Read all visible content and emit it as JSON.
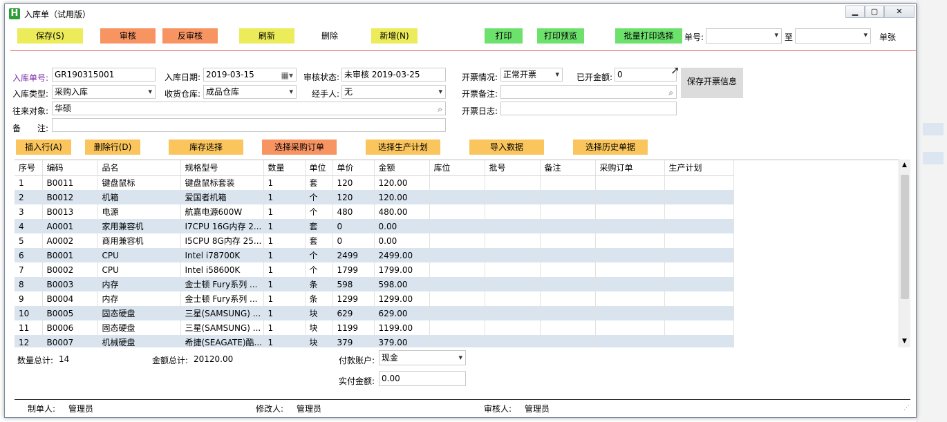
{
  "window": {
    "icon_letter": "H",
    "title": "入库单（试用版）",
    "min": "▭",
    "max": "◘",
    "close": "✕"
  },
  "toolbar": {
    "save": "保存(S)",
    "audit": "审核",
    "unaudit": "反审核",
    "refresh": "刷新",
    "delete": "删除",
    "new": "新增(N)",
    "print": "打印",
    "preview": "打印预览",
    "batch_print": "批量打印选择",
    "no_label": "单号:",
    "to_label": "至",
    "sheet_label": "单张"
  },
  "form": {
    "receipt_no_label": "入库单号:",
    "receipt_no": "GR190315001",
    "date_label": "入库日期:",
    "date": "2019-03-15",
    "audit_status_label": "审核状态:",
    "audit_status": "未审核 2019-03-25",
    "type_label": "入库类型:",
    "type": "采购入库",
    "warehouse_label": "收货仓库:",
    "warehouse": "成品仓库",
    "handler_label": "经手人:",
    "handler": "无",
    "partner_label": "往来对象:",
    "partner": "华硕",
    "remark_label": "备　　注:",
    "remark": "",
    "invoice_status_label": "开票情况:",
    "invoice_status": "正常开票",
    "invoiced_amount_label": "已开金额:",
    "invoiced_amount": "0",
    "invoice_remark_label": "开票备注:",
    "invoice_remark": "",
    "invoice_log_label": "开票日志:",
    "invoice_log": "",
    "save_invoice": "保存开票信息"
  },
  "row_buttons": {
    "insert": "插入行(A)",
    "delete": "删除行(D)",
    "stock": "库存选择",
    "purchase": "选择采购订单",
    "production": "选择生产计划",
    "import": "导入数据",
    "history": "选择历史单据"
  },
  "table": {
    "headers": [
      "序号",
      "编码",
      "品名",
      "规格型号",
      "数量",
      "单位",
      "单价",
      "金额",
      "库位",
      "批号",
      "备注",
      "采购订单",
      "生产计划"
    ],
    "rows": [
      [
        "1",
        "B0011",
        "键盘鼠标",
        "键盘鼠标套装",
        "1",
        "套",
        "120",
        "120.00",
        "",
        "",
        "",
        "",
        ""
      ],
      [
        "2",
        "B0012",
        "机箱",
        "爱国者机箱",
        "1",
        "个",
        "120",
        "120.00",
        "",
        "",
        "",
        "",
        ""
      ],
      [
        "3",
        "B0013",
        "电源",
        "航嘉电源600W",
        "1",
        "个",
        "480",
        "480.00",
        "",
        "",
        "",
        "",
        ""
      ],
      [
        "4",
        "A0001",
        "家用兼容机",
        "I7CPU 16G内存 2...",
        "1",
        "套",
        "0",
        "0.00",
        "",
        "",
        "",
        "",
        ""
      ],
      [
        "5",
        "A0002",
        "商用兼容机",
        "I5CPU 8G内存 25...",
        "1",
        "套",
        "0",
        "0.00",
        "",
        "",
        "",
        "",
        ""
      ],
      [
        "6",
        "B0001",
        "CPU",
        "Intel i78700K",
        "1",
        "个",
        "2499",
        "2499.00",
        "",
        "",
        "",
        "",
        ""
      ],
      [
        "7",
        "B0002",
        "CPU",
        "Intel i58600K",
        "1",
        "个",
        "1799",
        "1799.00",
        "",
        "",
        "",
        "",
        ""
      ],
      [
        "8",
        "B0003",
        "内存",
        "金士顿 Fury系列 ...",
        "1",
        "条",
        "598",
        "598.00",
        "",
        "",
        "",
        "",
        ""
      ],
      [
        "9",
        "B0004",
        "内存",
        "金士顿 Fury系列 ...",
        "1",
        "条",
        "1299",
        "1299.00",
        "",
        "",
        "",
        "",
        ""
      ],
      [
        "10",
        "B0005",
        "固态硬盘",
        "三星(SAMSUNG) ...",
        "1",
        "块",
        "629",
        "629.00",
        "",
        "",
        "",
        "",
        ""
      ],
      [
        "11",
        "B0006",
        "固态硬盘",
        "三星(SAMSUNG) ...",
        "1",
        "块",
        "1199",
        "1199.00",
        "",
        "",
        "",
        "",
        ""
      ],
      [
        "12",
        "B0007",
        "机械硬盘",
        "希捷(SEAGATE)酷...",
        "1",
        "块",
        "379",
        "379.00",
        "",
        "",
        "",
        "",
        ""
      ]
    ]
  },
  "summary": {
    "qty_label": "数量总计:",
    "qty": "14",
    "amount_label": "金额总计:",
    "amount": "20120.00",
    "account_label": "付款账户:",
    "account": "现金",
    "paid_label": "实付金额:",
    "paid": "0.00"
  },
  "footer": {
    "maker_label": "制单人:",
    "maker": "管理员",
    "modifier_label": "修改人:",
    "modifier": "管理员",
    "auditor_label": "审核人:",
    "auditor": "管理员"
  },
  "colors": {
    "yellow": "#ecec5a",
    "orange": "#f79462",
    "green": "#6ce16c",
    "alt_row": "#d9e4ef",
    "light_orange": "#fac55c"
  }
}
